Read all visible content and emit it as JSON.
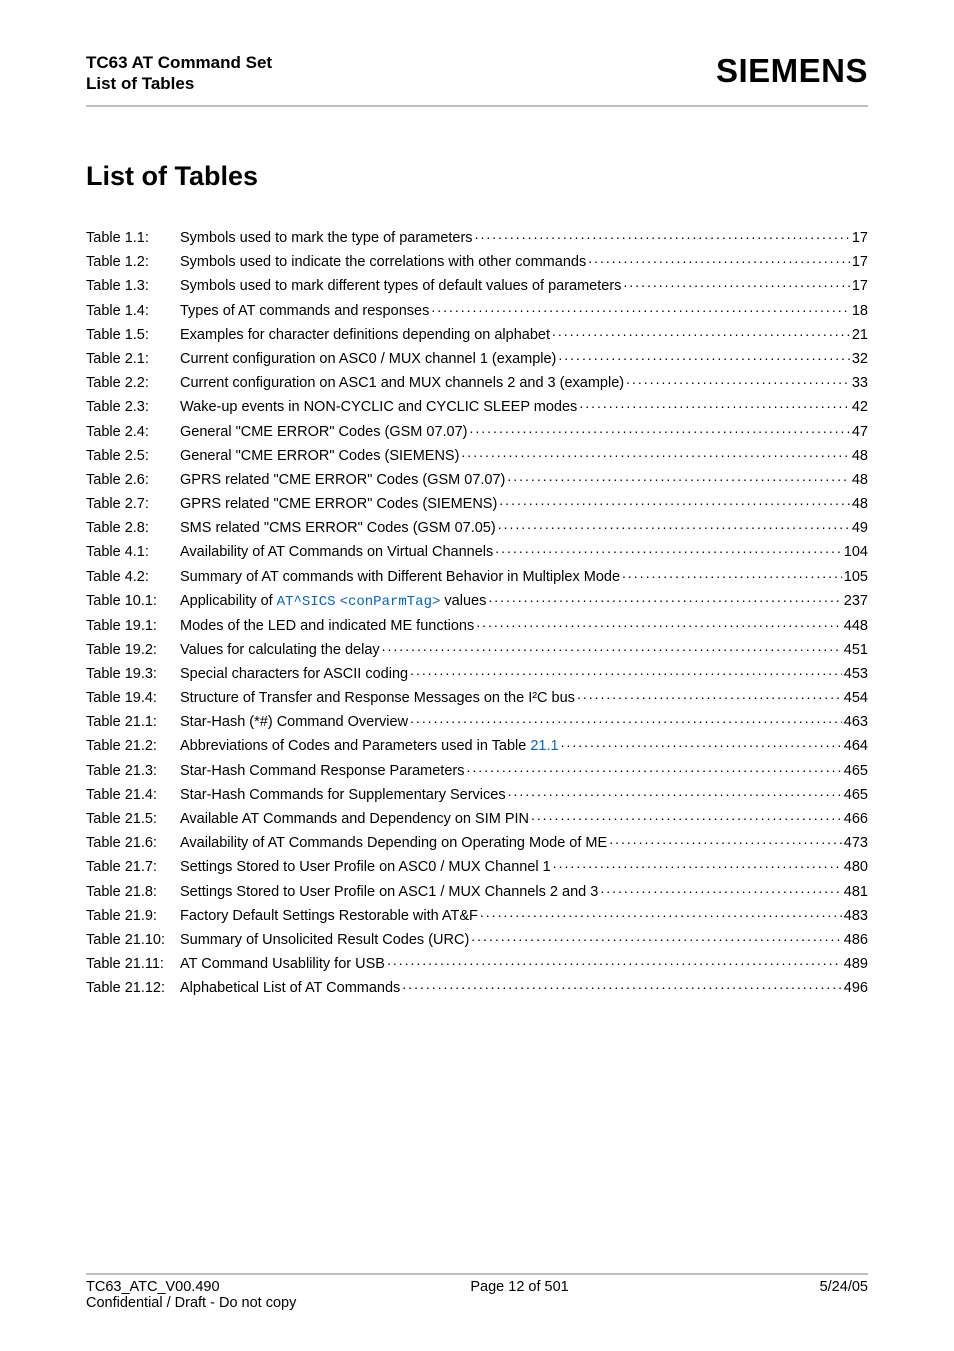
{
  "header": {
    "title_line1": "TC63 AT Command Set",
    "title_line2": "List of Tables",
    "brand": "SIEMENS"
  },
  "page_title": "List of Tables",
  "entries": [
    {
      "label": "Table 1.1:",
      "desc": "Symbols used to mark the type of parameters ",
      "page": "17"
    },
    {
      "label": "Table 1.2:",
      "desc": "Symbols used to indicate the correlations with other commands",
      "page": "17"
    },
    {
      "label": "Table 1.3:",
      "desc": "Symbols used to mark different types of default values of parameters ",
      "page": "17"
    },
    {
      "label": "Table 1.4:",
      "desc": "Types of AT commands and responses ",
      "page": "18"
    },
    {
      "label": "Table 1.5:",
      "desc": "Examples for character definitions depending on alphabet",
      "page": "21"
    },
    {
      "label": "Table 2.1:",
      "desc": "Current configuration on ASC0 / MUX channel 1 (example) ",
      "page": "32"
    },
    {
      "label": "Table 2.2:",
      "desc": "Current configuration on ASC1 and MUX channels 2 and 3 (example) ",
      "page": "33"
    },
    {
      "label": "Table 2.3:",
      "desc": "Wake-up events in NON-CYCLIC and CYCLIC SLEEP modes",
      "page": "42"
    },
    {
      "label": "Table 2.4:",
      "desc": "General \"CME ERROR\" Codes (GSM 07.07) ",
      "page": "47"
    },
    {
      "label": "Table 2.5:",
      "desc": "General \"CME ERROR\" Codes (SIEMENS) ",
      "page": "48"
    },
    {
      "label": "Table 2.6:",
      "desc": "GPRS related \"CME ERROR\" Codes (GSM 07.07) ",
      "page": "48"
    },
    {
      "label": "Table 2.7:",
      "desc": "GPRS related \"CME ERROR\" Codes (SIEMENS) ",
      "page": "48"
    },
    {
      "label": "Table 2.8:",
      "desc": "SMS related \"CMS ERROR\" Codes (GSM 07.05) ",
      "page": "49"
    },
    {
      "label": "Table 4.1:",
      "desc": "Availability of AT Commands on Virtual Channels ",
      "page": "104"
    },
    {
      "label": "Table 4.2:",
      "desc": "Summary of AT commands with Different Behavior in Multiplex Mode ",
      "page": "105"
    },
    {
      "label": "Table 10.1:",
      "desc_parts": [
        "Applicability of ",
        {
          "code": "AT^SICS"
        },
        " ",
        {
          "code": "<conParmTag>"
        },
        " values "
      ],
      "page": "237"
    },
    {
      "label": "Table 19.1:",
      "desc": "Modes of the LED and indicated ME functions",
      "page": "448"
    },
    {
      "label": "Table 19.2:",
      "desc": "Values for calculating the delay",
      "page": "451"
    },
    {
      "label": "Table 19.3:",
      "desc": "Special characters for ASCII coding",
      "page": "453"
    },
    {
      "label": "Table 19.4:",
      "desc": "Structure of Transfer and Response Messages on the I²C bus",
      "page": "454"
    },
    {
      "label": "Table 21.1:",
      "desc": "Star-Hash (*#) Command Overview ",
      "page": "463"
    },
    {
      "label": "Table 21.2:",
      "desc_parts": [
        "Abbreviations of Codes and Parameters used in Table ",
        {
          "linkref": "21.1"
        },
        " "
      ],
      "page": "464"
    },
    {
      "label": "Table 21.3:",
      "desc": "Star-Hash Command Response Parameters ",
      "page": "465"
    },
    {
      "label": "Table 21.4:",
      "desc": "Star-Hash Commands for Supplementary Services ",
      "page": "465"
    },
    {
      "label": "Table 21.5:",
      "desc": "Available AT Commands and Dependency on SIM PIN",
      "page": "466"
    },
    {
      "label": "Table 21.6:",
      "desc": "Availability of AT Commands Depending on Operating Mode of ME ",
      "page": "473"
    },
    {
      "label": "Table 21.7:",
      "desc": "Settings Stored to User Profile on ASC0 / MUX Channel 1",
      "page": "480"
    },
    {
      "label": "Table 21.8:",
      "desc": "Settings Stored to User Profile on ASC1 / MUX Channels 2 and 3",
      "page": "481"
    },
    {
      "label": "Table 21.9:",
      "desc": "Factory Default Settings Restorable with AT&F ",
      "page": "483"
    },
    {
      "label": "Table 21.10:",
      "desc": "Summary of Unsolicited Result Codes (URC)",
      "page": "486"
    },
    {
      "label": "Table 21.11:",
      "desc": "AT Command Usablility for USB",
      "page": "489"
    },
    {
      "label": "Table 21.12:",
      "desc": "Alphabetical List of AT Commands",
      "page": "496"
    }
  ],
  "footer": {
    "left_line1": "TC63_ATC_V00.490",
    "left_line2": "Confidential / Draft - Do not copy",
    "center": "Page 12 of 501",
    "right": "5/24/05"
  }
}
